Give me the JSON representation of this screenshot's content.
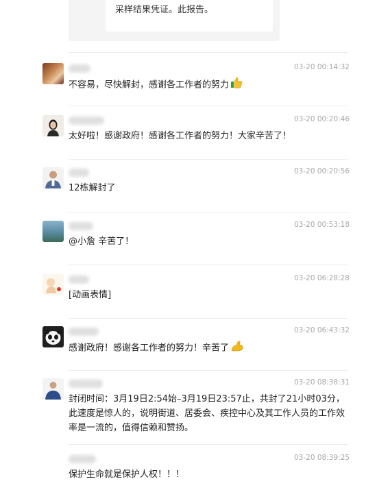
{
  "quote": {
    "text": "采样结果凭证。此报告。"
  },
  "messages": [
    {
      "time": "03-20 00:14:32",
      "text": "不容易，尽快解封，感谢各工作者的努力",
      "emoji": "thumbs-up-icon"
    },
    {
      "time": "03-20 00:20:46",
      "text": "太好啦！感谢政府！感谢各工作者的努力！大家辛苦了！"
    },
    {
      "time": "03-20 00:20:56",
      "text": "12栋解封了"
    },
    {
      "time": "03-20 00:53:18",
      "text": "@小詹 辛苦了！"
    },
    {
      "time": "03-20 06:28:28",
      "text": "[动画表情]"
    },
    {
      "time": "03-20 06:43:32",
      "text": "感谢政府！感谢各工作者的努力！辛苦了",
      "emoji": "strong-arm-icon"
    },
    {
      "time": "03-20 08:38:31",
      "text": "封闭时间：3月19日2:54始–3月19日23:57止，共封了21小时03分，此速度是惊人的，说明街道、居委会、疾控中心及其工作人员的工作效率是一流的，值得信赖和赞扬。"
    },
    {
      "time": "03-20 08:39:25",
      "text": "保护生命就是保护人权！！！"
    }
  ],
  "colors": {
    "timestamp": "#a8a8a8",
    "divider": "#ececec",
    "text": "#222222"
  }
}
